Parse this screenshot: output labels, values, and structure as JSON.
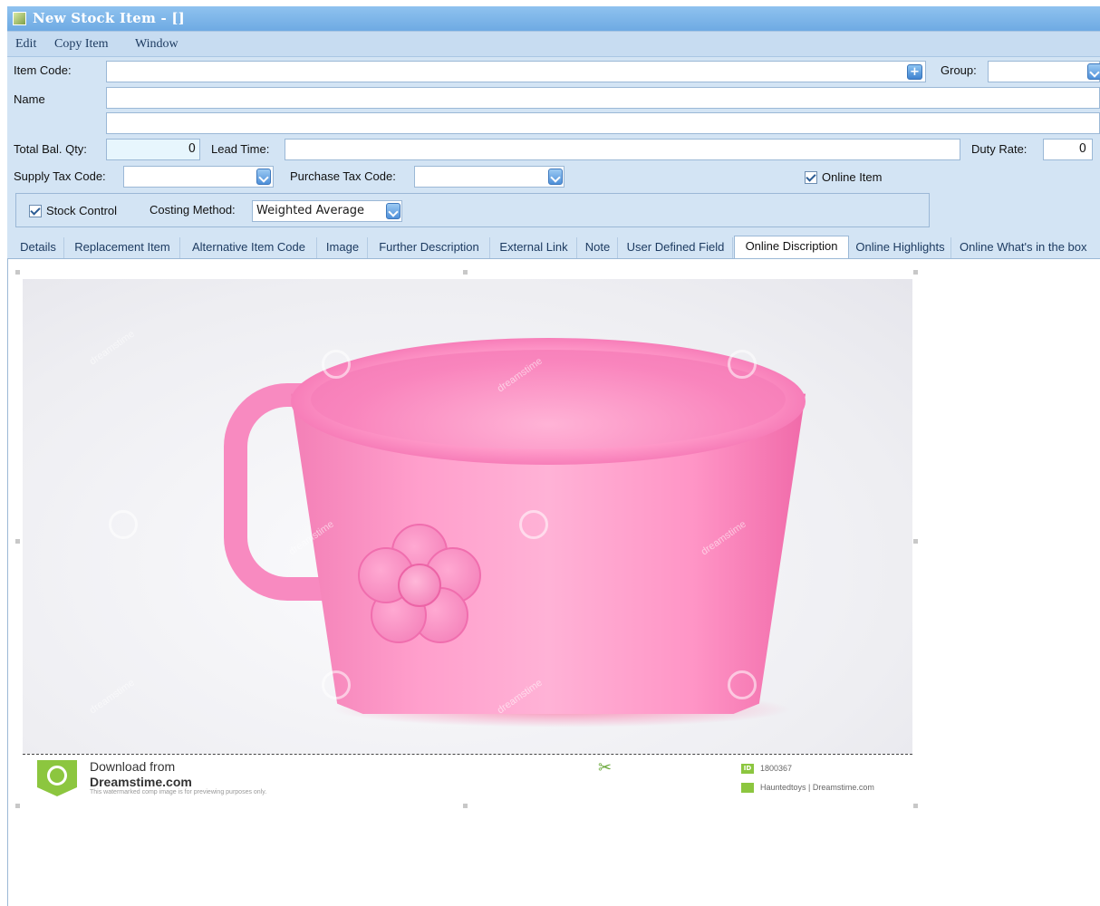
{
  "window": {
    "title": "New Stock Item - []"
  },
  "menu": {
    "items": [
      "Edit",
      "Copy Item",
      "Window"
    ]
  },
  "form": {
    "item_code_label": "Item Code:",
    "item_code_value": "",
    "group_label": "Group:",
    "group_value": "",
    "name_label": "Name",
    "name_value": "",
    "name2_value": "",
    "total_bal_qty_label": "Total Bal. Qty:",
    "total_bal_qty_value": "0",
    "lead_time_label": "Lead Time:",
    "lead_time_value": "",
    "duty_rate_label": "Duty Rate:",
    "duty_rate_value": "0",
    "supply_tax_code_label": "Supply Tax Code:",
    "supply_tax_code_value": "",
    "purchase_tax_code_label": "Purchase Tax Code:",
    "purchase_tax_code_value": "",
    "online_item_label": "Online Item",
    "online_item_checked": true,
    "stock_control_label": "Stock Control",
    "stock_control_checked": true,
    "costing_method_label": "Costing Method:",
    "costing_method_value": "Weighted Average"
  },
  "tabs": [
    {
      "label": "Details",
      "active": false
    },
    {
      "label": "Replacement Item",
      "active": false
    },
    {
      "label": "Alternative Item Code",
      "active": false
    },
    {
      "label": "Image",
      "active": false
    },
    {
      "label": "Further Description",
      "active": false
    },
    {
      "label": "External Link",
      "active": false
    },
    {
      "label": "Note",
      "active": false
    },
    {
      "label": "User Defined Field",
      "active": false
    },
    {
      "label": "Online Discription",
      "active": true
    },
    {
      "label": "Online Highlights",
      "active": false
    },
    {
      "label": "Online What's in the box",
      "active": false
    }
  ],
  "image": {
    "watermark_text": "dreamstime",
    "footer": {
      "line1": "Download from",
      "line2": "Dreamstime.com",
      "line3": "This watermarked comp image is for previewing purposes only.",
      "id_badge": "ID",
      "id_value": "1800367",
      "author": "Hauntedtoys | Dreamstime.com"
    }
  },
  "colors": {
    "titlebar": "#7ab3e8",
    "form_bg": "#d3e4f4",
    "cup_pink": "#ff9fcc",
    "logo_green": "#8cc63f"
  }
}
